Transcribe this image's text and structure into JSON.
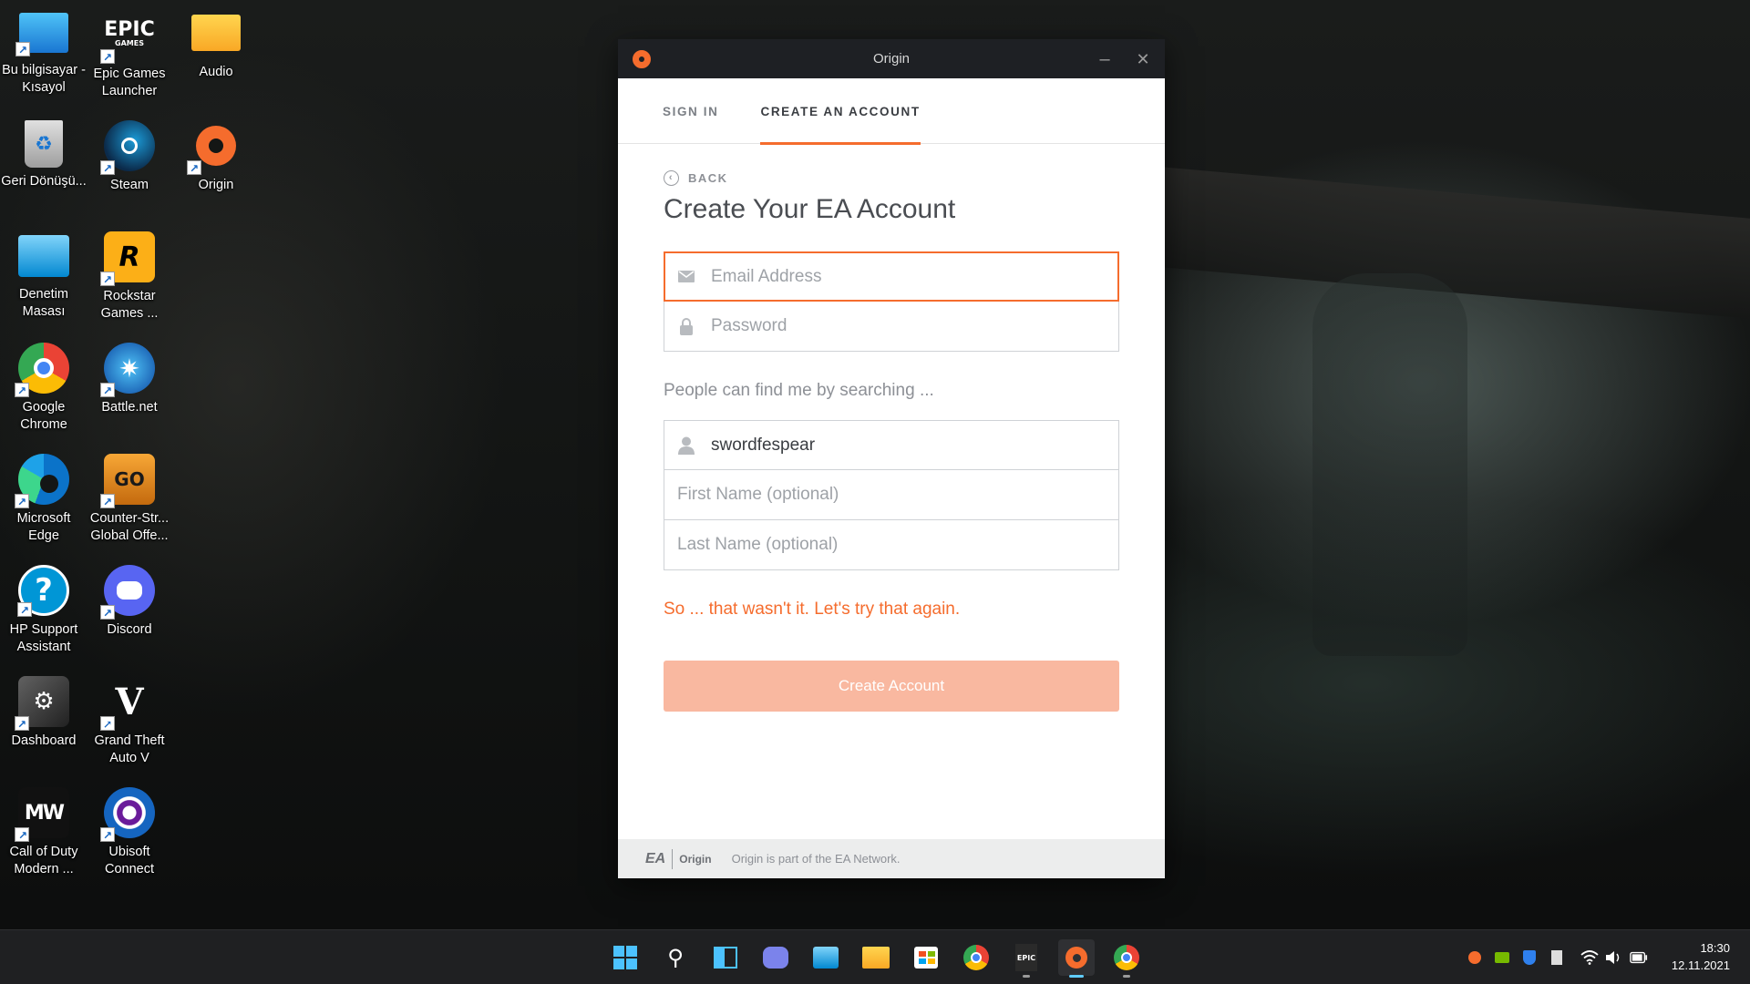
{
  "desktop": {
    "icons": [
      {
        "label": "Bu bilgisayar - Kısayol",
        "icon": "computer-icon"
      },
      {
        "label": "Epic Games Launcher",
        "icon": "epic-games-icon"
      },
      {
        "label": "Audio",
        "icon": "folder-icon"
      },
      {
        "label": "Geri Dönüşü...",
        "icon": "recycle-bin-icon"
      },
      {
        "label": "Steam",
        "icon": "steam-icon"
      },
      {
        "label": "Origin",
        "icon": "origin-icon"
      },
      {
        "label": "Denetim Masası",
        "icon": "control-panel-icon"
      },
      {
        "label": "Rockstar Games ...",
        "icon": "rockstar-icon"
      },
      {
        "label": "Google Chrome",
        "icon": "chrome-icon"
      },
      {
        "label": "Battle.net",
        "icon": "battlenet-icon"
      },
      {
        "label": "Microsoft Edge",
        "icon": "edge-icon"
      },
      {
        "label": "Counter-Str... Global Offe...",
        "icon": "csgo-icon"
      },
      {
        "label": "HP Support Assistant",
        "icon": "hp-support-icon"
      },
      {
        "label": "Discord",
        "icon": "discord-icon"
      },
      {
        "label": "Dashboard",
        "icon": "dashboard-icon"
      },
      {
        "label": "Grand Theft Auto V",
        "icon": "gta-v-icon"
      },
      {
        "label": "Call of Duty Modern ...",
        "icon": "call-of-duty-icon"
      },
      {
        "label": "Ubisoft Connect",
        "icon": "ubisoft-icon"
      }
    ],
    "icon_text": {
      "epic_logo": "EPIC",
      "epic_sub": "GAMES",
      "rockstar_logo": "R",
      "csgo_logo": "GO",
      "gta_logo": "V",
      "cod_logo": "MW"
    }
  },
  "window": {
    "title": "Origin",
    "minimize_glyph": "–",
    "close_glyph": "✕",
    "tabs": [
      {
        "label": "SIGN IN",
        "active": false
      },
      {
        "label": "CREATE AN ACCOUNT",
        "active": true
      }
    ],
    "back_label": "BACK",
    "heading": "Create Your EA Account",
    "email_placeholder": "Email Address",
    "password_placeholder": "Password",
    "search_hint": "People can find me by searching ...",
    "username_value": "swordfespear",
    "first_name_placeholder": "First Name (optional)",
    "last_name_placeholder": "Last Name (optional)",
    "error_message": "So ... that wasn't it. Let's try that again.",
    "create_button": "Create Account",
    "footer_ea": "EA",
    "footer_brand": "Origin",
    "footer_text": "Origin is part of the EA Network."
  },
  "taskbar": {
    "apps": [
      "start-icon",
      "search-icon",
      "widgets-icon",
      "teams-chat-icon",
      "control-panel-icon",
      "file-explorer-icon",
      "microsoft-store-icon",
      "chrome-icon",
      "epic-games-icon",
      "origin-icon",
      "chrome-icon"
    ],
    "epic_text": "EPIC",
    "clock_time": "18:30",
    "clock_date": "12.11.2021"
  },
  "colors": {
    "accent": "#f56c2d",
    "button_disabled": "#f9b8a0",
    "titlebar": "#1e2024"
  }
}
